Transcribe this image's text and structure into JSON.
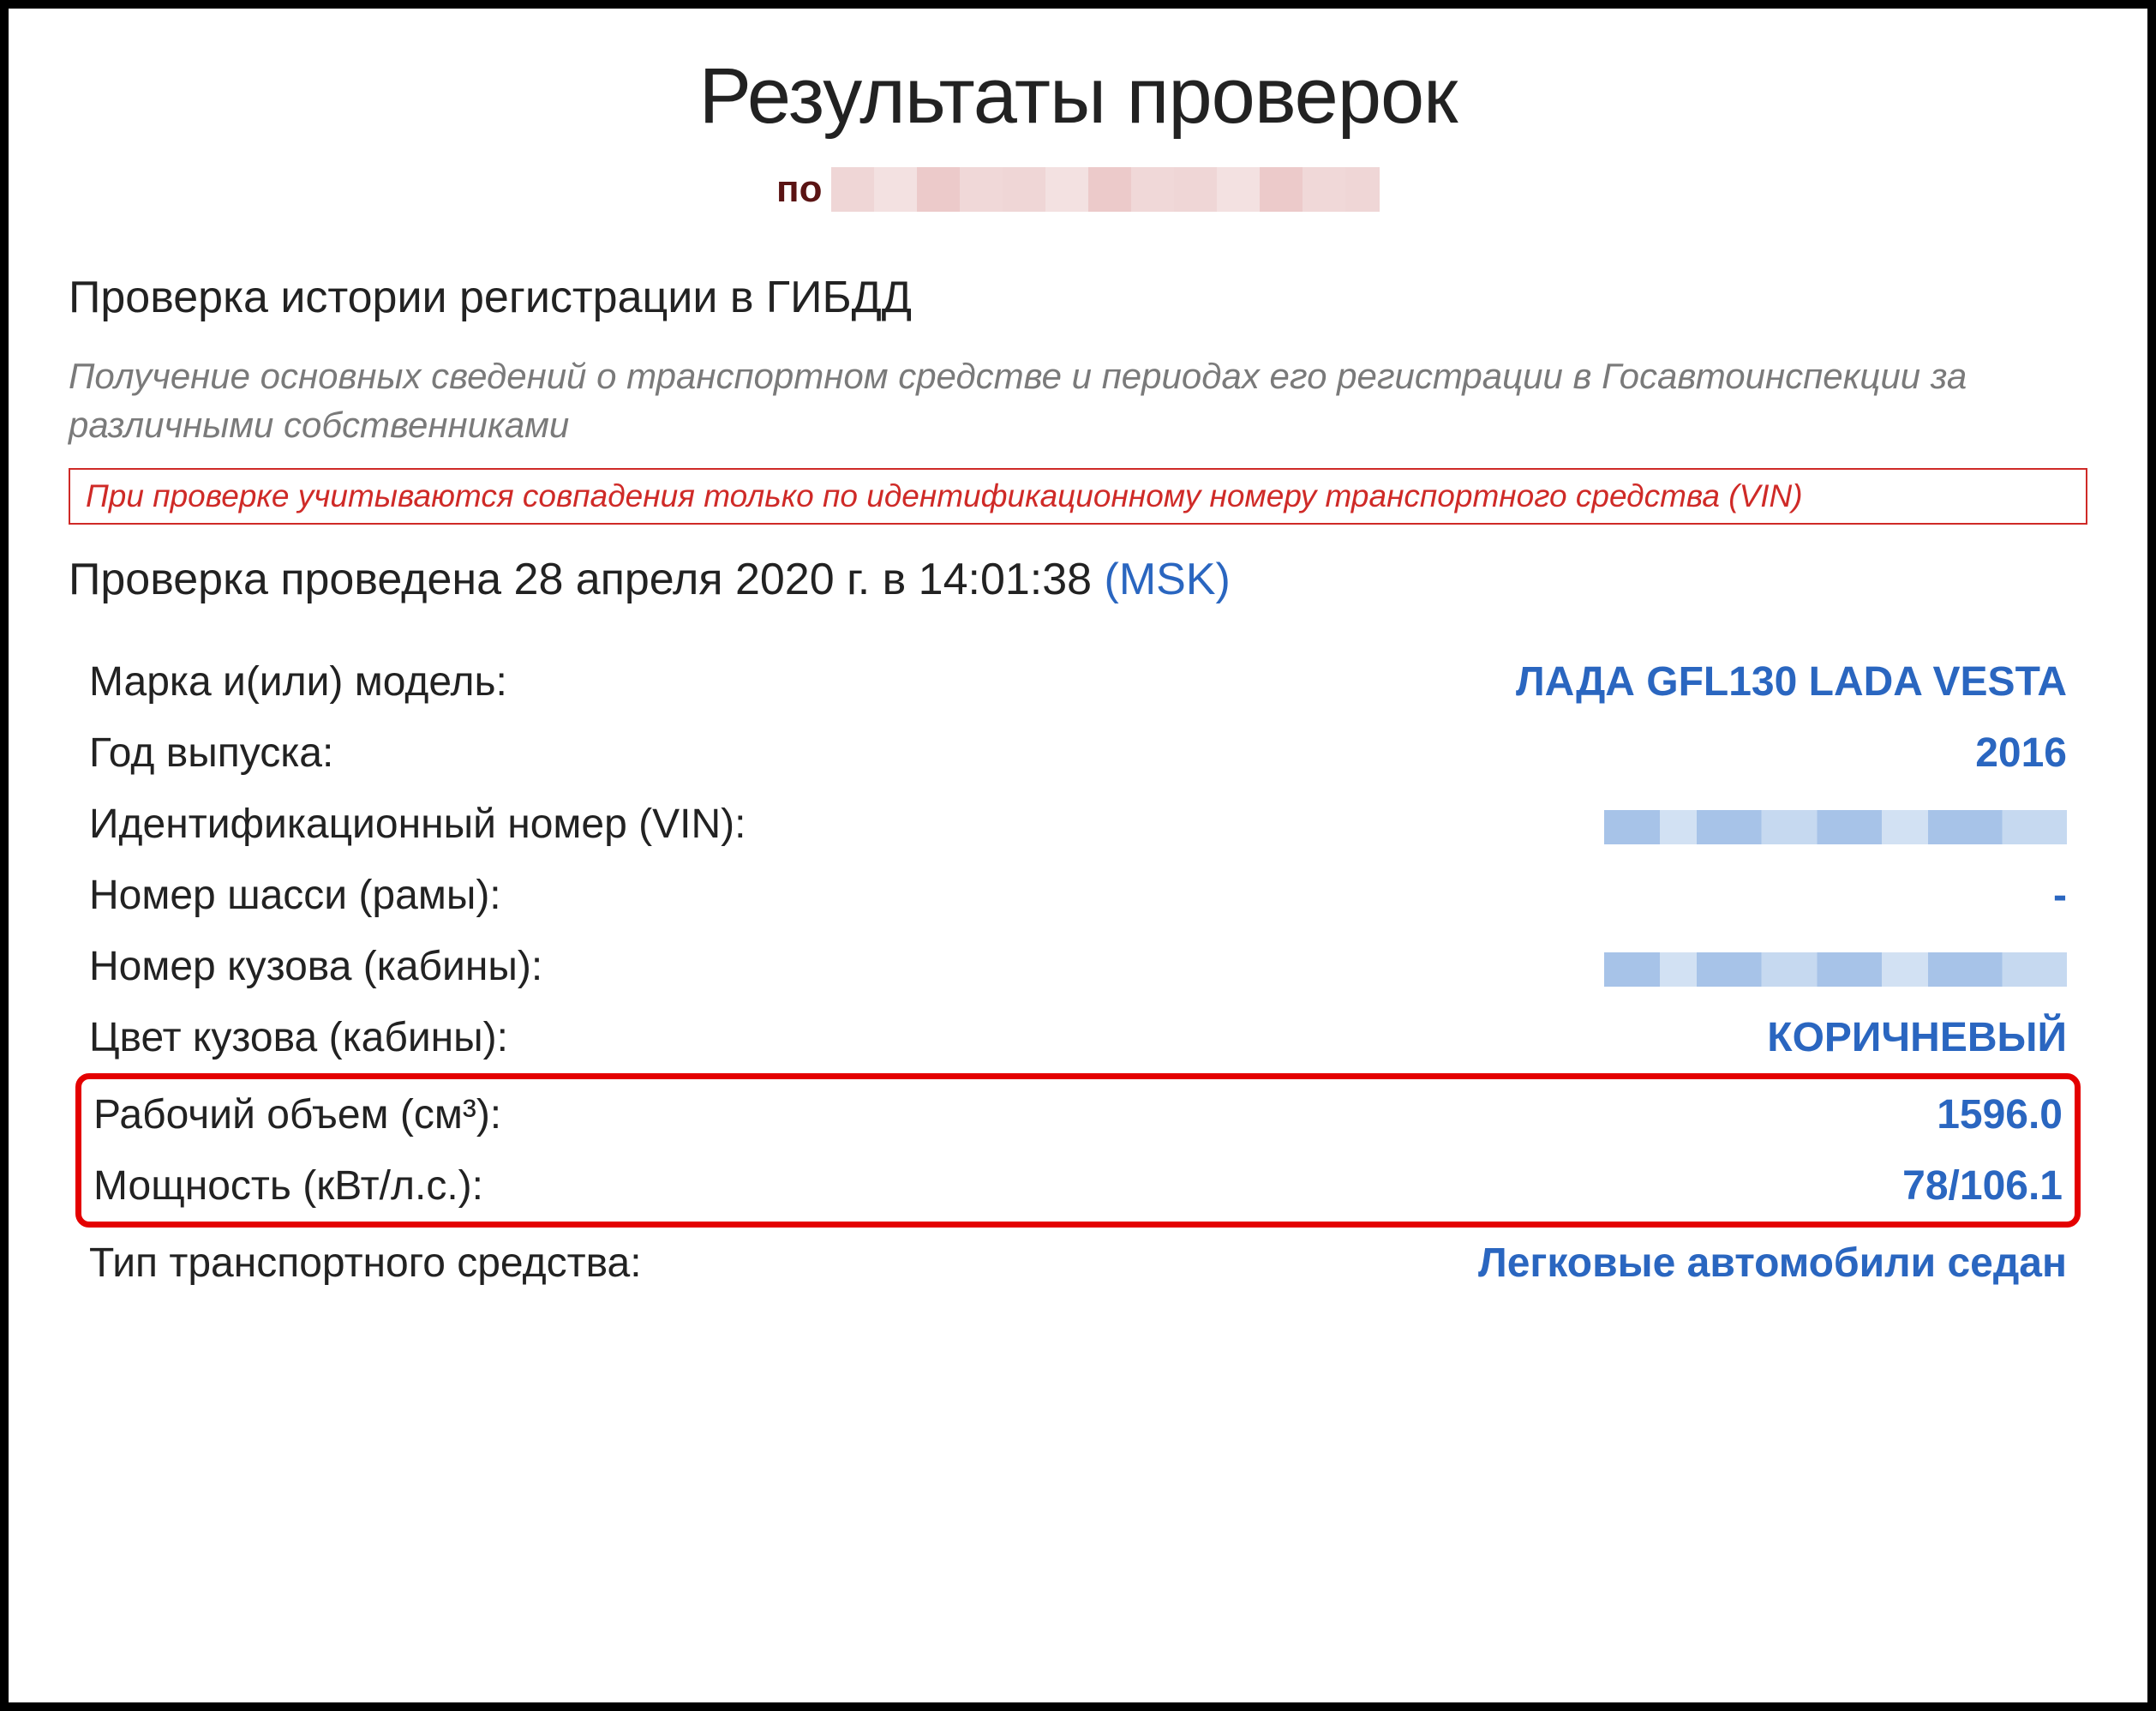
{
  "header": {
    "title": "Результаты проверок",
    "subtitle_prefix": "по"
  },
  "section": {
    "title": "Проверка истории регистрации в ГИБДД",
    "intro": "Получение основных сведений о транспортном средстве и периодах его регистрации в Госавтоинспекции за различными собственниками",
    "warning": "При проверке учитываются совпадения только по идентификационному номеру транспортного средства (VIN)",
    "timestamp_text": "Проверка проведена 28 апреля 2020 г. в 14:01:38 ",
    "timezone": "(MSK)"
  },
  "specs": {
    "model": {
      "label": "Марка и(или) модель:",
      "value": "ЛАДА GFL130 LADA VESTA"
    },
    "year": {
      "label": "Год выпуска:",
      "value": "2016"
    },
    "vin": {
      "label": "Идентификационный номер (VIN):",
      "value": ""
    },
    "chassis": {
      "label": "Номер шасси (рамы):",
      "value": "-"
    },
    "body_no": {
      "label": "Номер кузова (кабины):",
      "value": ""
    },
    "color": {
      "label": "Цвет кузова (кабины):",
      "value": "КОРИЧНЕВЫЙ"
    },
    "displacement": {
      "label": "Рабочий объем (см³):",
      "value": "1596.0"
    },
    "power": {
      "label": "Мощность (кВт/л.с.):",
      "value": "78/106.1"
    },
    "type": {
      "label": "Тип транспортного средства:",
      "value": "Легковые автомобили седан"
    }
  }
}
